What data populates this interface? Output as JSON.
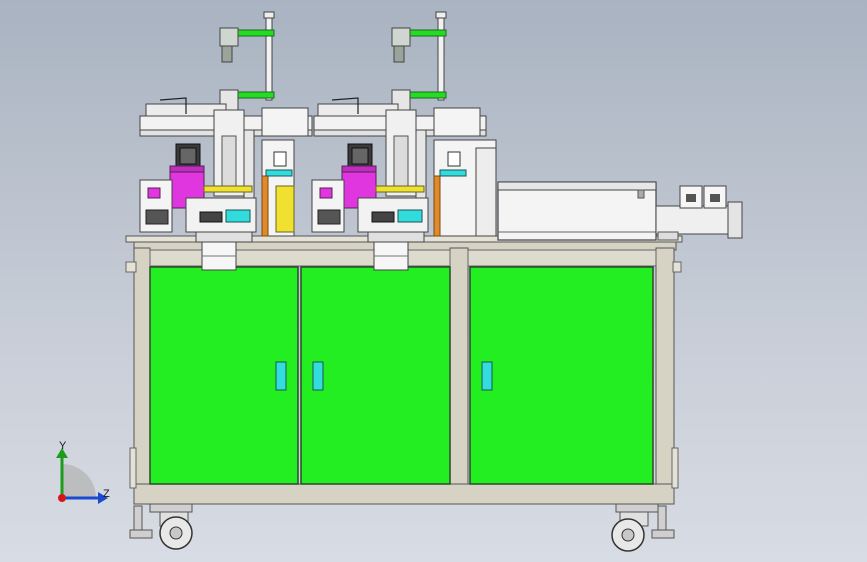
{
  "colors": {
    "frame": "#d6d3c4",
    "frame_edge": "#555555",
    "door": "#22ee22",
    "door_edge": "#2a4a2a",
    "handle": "#33dddd",
    "machine_white": "#f2f2f2",
    "magenta": "#e036e0",
    "cyan": "#33dcdc",
    "yellow": "#f0e030",
    "orange": "#e08a2a",
    "green_accent": "#22dd22",
    "axis_y": "#1c9c1c",
    "axis_z": "#1a4ad0",
    "axis_origin": "#d01818"
  },
  "triad": {
    "y_label": "Y",
    "z_label": "Z"
  }
}
